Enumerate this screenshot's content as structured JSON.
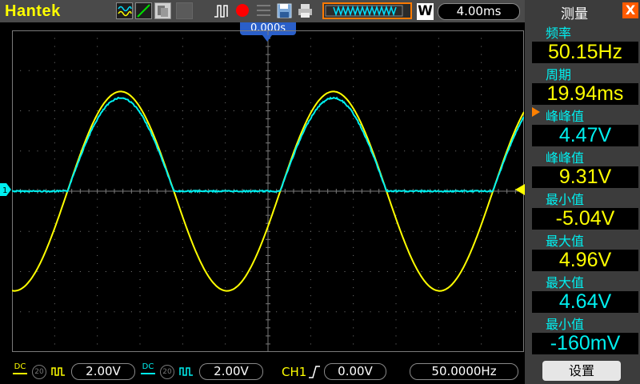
{
  "brand": "Hantek",
  "toolbar": {
    "run_stop_color": "#ff0000",
    "save_icon": "floppy-disk",
    "print_icon": "printer",
    "waveform_icon": "square-wave",
    "w_label": "W",
    "timebase": "4.00ms"
  },
  "trigger_position": "0.000s",
  "panel": {
    "title": "测量",
    "close": "X",
    "measurements": [
      {
        "label": "频率",
        "value": "50.15Hz",
        "color": "#ffff00"
      },
      {
        "label": "周期",
        "value": "19.94ms",
        "color": "#ffff00"
      },
      {
        "label": "峰峰值",
        "value": "4.47V",
        "color": "#00f0f0",
        "selected": true
      },
      {
        "label": "峰峰值",
        "value": "9.31V",
        "color": "#ffff00"
      },
      {
        "label": "最小值",
        "value": "-5.04V",
        "color": "#ffff00"
      },
      {
        "label": "最大值",
        "value": "4.96V",
        "color": "#ffff00"
      },
      {
        "label": "最大值",
        "value": "4.64V",
        "color": "#00f0f0"
      },
      {
        "label": "最小值",
        "value": "-160mV",
        "color": "#00f0f0"
      }
    ],
    "settings": "设置"
  },
  "bottom": {
    "ch1": {
      "coupling": "DC",
      "bw": "20",
      "scale": "2.00V",
      "color": "#ffff00"
    },
    "ch2": {
      "coupling": "DC",
      "bw": "20",
      "scale": "2.00V",
      "color": "#00f0f0"
    },
    "trigger": {
      "source": "CH1",
      "level": "0.00V"
    },
    "trigger_freq": "50.0000Hz"
  },
  "colors": {
    "ch1": "#ffff00",
    "ch2": "#00f0f0",
    "grid": "#7a7a7a"
  }
}
